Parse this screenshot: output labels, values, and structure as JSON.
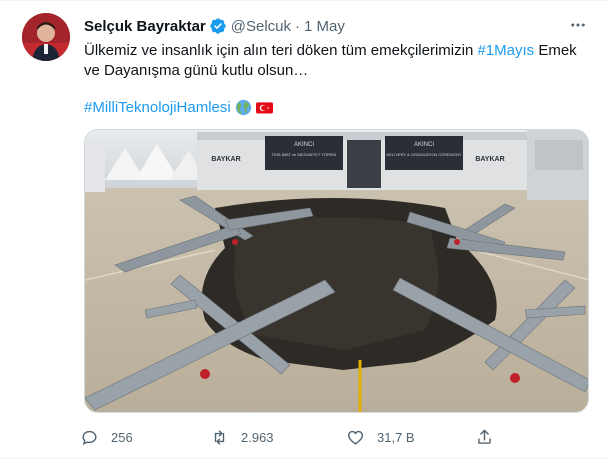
{
  "author": {
    "name": "Selçuk Bayraktar",
    "handle": "@Selcuk",
    "separator": "·",
    "date": "1 May"
  },
  "tweet": {
    "text_part1": "Ülkemiz ve insanlık için alın teri döken tüm emekçilerimizin ",
    "hashtag1": "#1Mayıs",
    "text_part2": " Emek ve Dayanışma günü kutlu olsun…",
    "hashtag2": "#MilliTeknolojiHamlesi"
  },
  "media": {
    "banner_left_title": "AKINCI",
    "banner_left_sub": "TESLİMAT ve MEZUNİYET TÖRENİ",
    "banner_right_title": "AKINCI",
    "banner_right_sub": "DELIVERY & GRADUATION CEREMONY",
    "brand_left": "BAYKAR",
    "brand_right": "BAYKAR"
  },
  "actions": {
    "replies": "256",
    "retweets": "2.963",
    "likes": "31,7 B"
  },
  "colors": {
    "link": "#1d9bf0",
    "secondary_text": "#536471",
    "verified": "#1d9bf0"
  },
  "icons": {
    "verified": "verified-badge-icon",
    "more": "more-icon",
    "reply": "reply-icon",
    "retweet": "retweet-icon",
    "like": "like-icon",
    "share": "share-icon",
    "globe_emoji": "globe-emoji-icon",
    "flag_emoji": "turkey-flag-emoji-icon"
  }
}
